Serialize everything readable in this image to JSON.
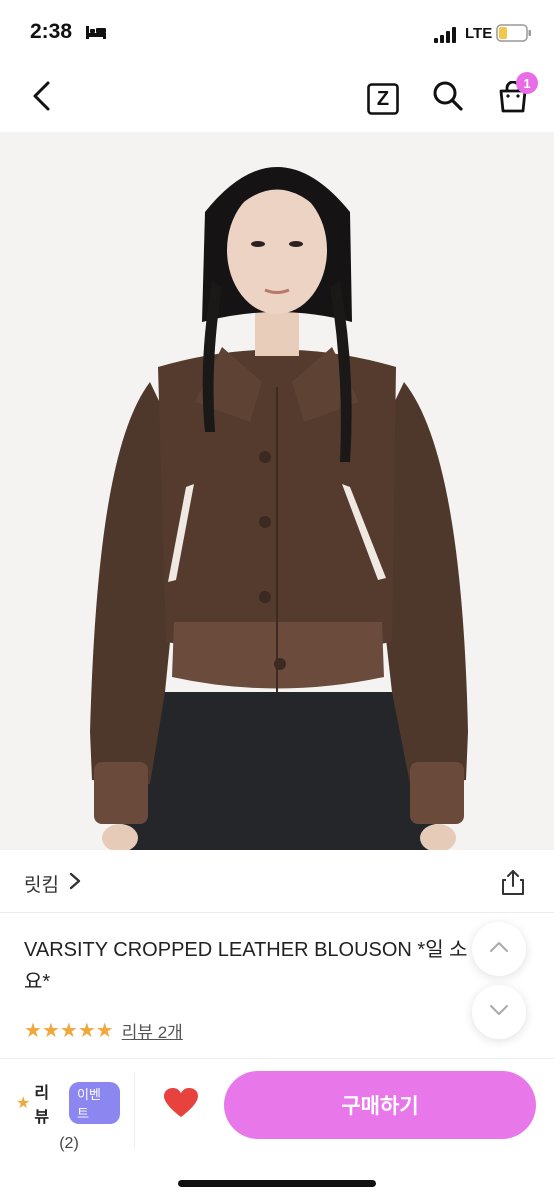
{
  "status_bar": {
    "time": "2:38",
    "network": "LTE"
  },
  "nav": {
    "z_label": "Z",
    "cart_count": "1"
  },
  "brand": {
    "name": "릿킴"
  },
  "product": {
    "title": "VARSITY CROPPED LEATHER BLOUSON *일 소요*",
    "rating": 5,
    "review_link": "리뷰 2개"
  },
  "bottom_bar": {
    "review_label": "리뷰",
    "event_badge": "이벤트",
    "review_count": "(2)",
    "buy_label": "구매하기"
  },
  "colors": {
    "accent": "#e878ea",
    "badge": "#e76ce6",
    "event": "#8b86f0",
    "star": "#f0a73b",
    "heart": "#e8423f"
  }
}
